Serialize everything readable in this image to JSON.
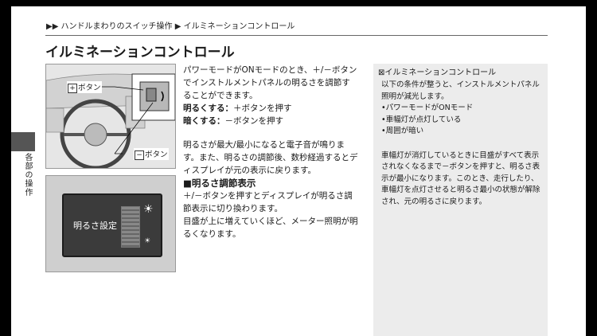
{
  "breadcrumb": "▶▶ ハンドルまわりのスイッチ操作 ▶ イルミネーションコントロール",
  "title": "イルミネーションコントロール",
  "side_tab_label": "各部の操作",
  "figure1": {
    "plus_button_label": "ボタン",
    "minus_button_label": "ボタン"
  },
  "figure2": {
    "display_text": "明るさ設定"
  },
  "main": {
    "intro": "パワーモードがONモードのとき、＋/－ボタンでインストルメントパネルの明るさを調節することができます。",
    "brighter_label": "明るくする：",
    "brighter_text": "＋ボタンを押す",
    "darker_label": "暗くする：",
    "darker_text": "－ボタンを押す",
    "limit_text": "明るさが最大/最小になると電子音が鳴ります。また、明るさの調節後、数秒経過するとディスプレイが元の表示に戻ります。",
    "section_heading": "■明るさ調節表示",
    "section_text1": "＋/－ボタンを押すとディスプレイが明るさ調節表示に切り換わります。",
    "section_text2": "目盛が上に増えていくほど、メーター照明が明るくなります。"
  },
  "sidebar": {
    "heading": "⊠イルミネーションコントロール",
    "intro": "以下の条件が整うと、インストルメントパネル照明が減光します。",
    "conditions": [
      "パワーモードがONモード",
      "車幅灯が点灯している",
      "周囲が暗い"
    ],
    "note": "車幅灯が消灯しているときに目盛がすべて表示されなくなるまで－ボタンを押すと、明るさ表示が最小になります。このとき、走行したり、車幅灯を点灯させると明るさ最小の状態が解除され、元の明るさに戻ります。"
  }
}
